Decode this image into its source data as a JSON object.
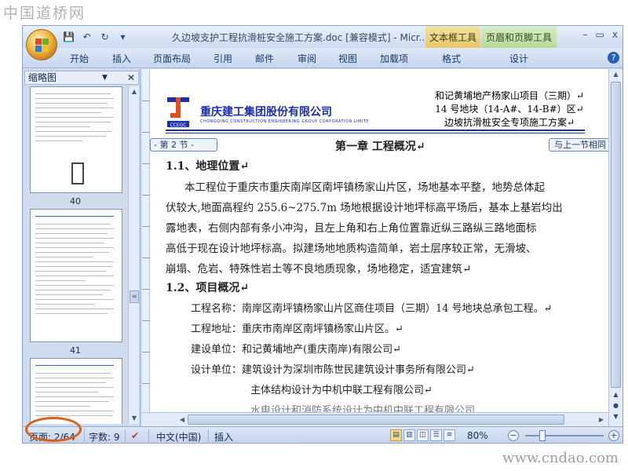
{
  "watermarks": {
    "top": "中国道桥网",
    "bottom": "www.cndao.com"
  },
  "titlebar": {
    "doc_title": "久边坡支护工程抗滑桩安全施工方案.doc [兼容模式] - Micr...",
    "context_tab_textbox": "文本框工具",
    "context_tab_header": "页眉和页脚工具",
    "win_minimize": "–",
    "win_restore": "▭",
    "win_close": "x",
    "help": "?"
  },
  "ribbon_tabs": [
    "开始",
    "插入",
    "页面布局",
    "引用",
    "邮件",
    "审阅",
    "视图",
    "加载项",
    "格式",
    "设计"
  ],
  "nav_pane": {
    "view_label": "缩略图",
    "dropdown_icon": "▼",
    "close_icon": "✕",
    "thumb_numbers": [
      "40",
      "41"
    ]
  },
  "document": {
    "header_lines": [
      "和记黄埔地产杨家山项目（三期）↵",
      "14 号地块（14-A#、14-B#）区↵",
      "边坡抗滑桩安全专项施工方案↵"
    ],
    "company_name": "重庆建工集团股份有限公司",
    "company_name_en": "CHONGQING CONSTRUCTION ENGINEERING GROUP CORPORATION LIMITE",
    "section_left": "- 第 2 节 -",
    "section_right": "与上一节相同",
    "chapter_title": "第一章  工程概况↵",
    "sec1_heading": "1.1、地理位置↵",
    "para1": [
      "本工程位于重庆市重庆南岸区南坪镇杨家山片区，场地基本平整，地势总体起",
      "伏较大,地面高程约 255.6~275.7m 场地根据设计地坪标高平场后，基本上基岩均出",
      "露地表，右侧内部有条小冲沟，且左上角和右上角位置靠近纵三路纵三路地面标",
      "高低于现在设计地坪标高。拟建场地地质构造简单，岩土层序较正常，无滑坡、",
      "崩塌、危岩、特殊性岩土等不良地质现象，场地稳定，适宜建筑↵"
    ],
    "sec2_heading": "1.2、项目概况↵",
    "items": [
      "工程名称：南岸区南坪镇杨家山片区商住项目（三期）14 号地块总承包工程。↵",
      "工程地址：重庆市南岸区南坪镇杨家山片区。↵",
      "建设单位：和记黄埔地产(重庆南岸)有限公司↵",
      "设计单位：建筑设计为深圳市陈世民建筑设计事务所有限公司↵",
      "主体结构设计为中机中联工程有限公司↵",
      "水电设计和消防系统设计为中机中联工程有限公司"
    ]
  },
  "status_bar": {
    "page": "页面: 2/64",
    "words": "字数: 9",
    "language": "中文(中国)",
    "mode": "插入",
    "zoom": "80%",
    "zoom_out": "−",
    "zoom_in": "+"
  },
  "colors": {
    "accent": "#d8621c",
    "company": "#1a2fa8"
  }
}
